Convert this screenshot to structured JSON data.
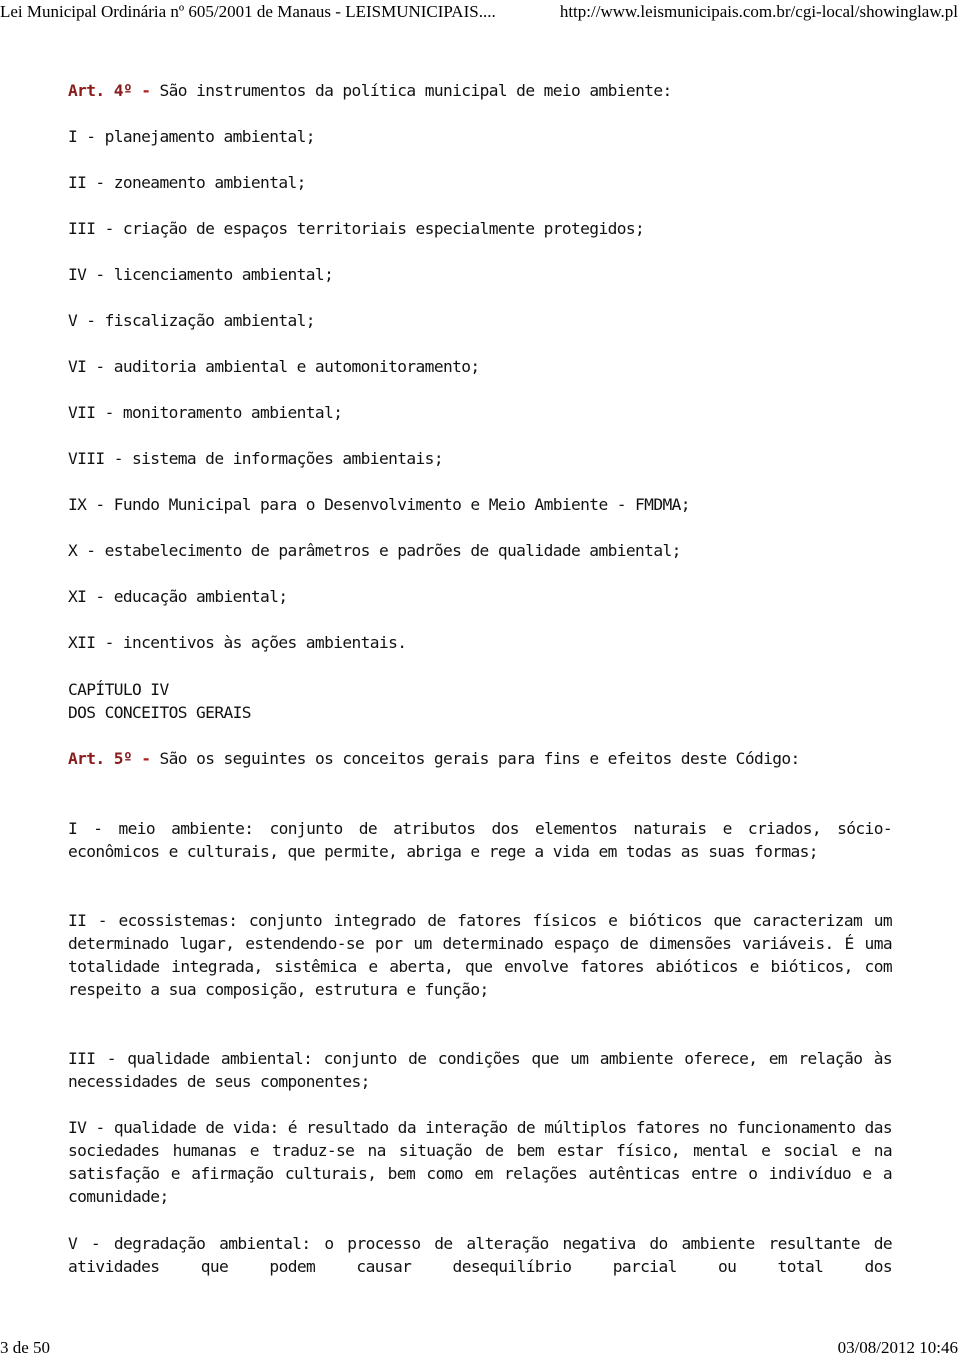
{
  "header": {
    "title": "Lei Municipal Ordinária nº 605/2001 de Manaus - LEISMUNICIPAIS....",
    "url": "http://www.leismunicipais.com.br/cgi-local/showinglaw.pl"
  },
  "art4": {
    "label": "Art. 4º",
    "dash": "-",
    "text": "São instrumentos da política municipal de meio ambiente:",
    "items": [
      "I - planejamento ambiental;",
      "II - zoneamento ambiental;",
      "III - criação de espaços territoriais especialmente protegidos;",
      "IV - licenciamento ambiental;",
      "V - fiscalização ambiental;",
      "VI - auditoria ambiental e automonitoramento;",
      "VII - monitoramento ambiental;",
      "VIII - sistema de informações ambientais;",
      "IX - Fundo Municipal para o Desenvolvimento e Meio Ambiente - FMDMA;",
      "X - estabelecimento de parâmetros e padrões de qualidade ambiental;",
      "XI - educação ambiental;",
      "XII - incentivos às ações ambientais."
    ]
  },
  "chapter": {
    "number": "CAPÍTULO IV",
    "title": "DOS CONCEITOS GERAIS"
  },
  "art5": {
    "label": "Art. 5º",
    "dash": "-",
    "text": "São os seguintes os conceitos gerais para fins e efeitos deste Código:",
    "items": [
      "I - meio ambiente: conjunto de atributos dos elementos naturais e criados, sócio-econômicos e culturais, que permite, abriga e rege a vida em todas as suas formas;",
      "II - ecossistemas: conjunto integrado de fatores físicos e bióticos que caracterizam um determinado lugar, estendendo-se por um determinado espaço de dimensões variáveis. É uma totalidade integrada, sistêmica e aberta, que envolve fatores abióticos e bióticos, com respeito a sua composição, estrutura e função;",
      "III - qualidade ambiental: conjunto de condições que um ambiente oferece, em relação às necessidades de seus componentes;",
      "IV - qualidade de vida: é resultado da interação de múltiplos fatores no funcionamento das sociedades humanas e traduz-se na situação de bem estar físico, mental e social e na satisfação e afirmação culturais, bem como em relações autênticas entre o indivíduo e a comunidade;",
      "V - degradação ambiental: o processo de alteração negativa do ambiente resultante de atividades que podem causar desequilíbrio parcial ou total dos"
    ]
  },
  "footer": {
    "page": "3 de 50",
    "datetime": "03/08/2012 10:46"
  },
  "colors": {
    "article_label": "#8b1a1a",
    "text": "#111111"
  }
}
